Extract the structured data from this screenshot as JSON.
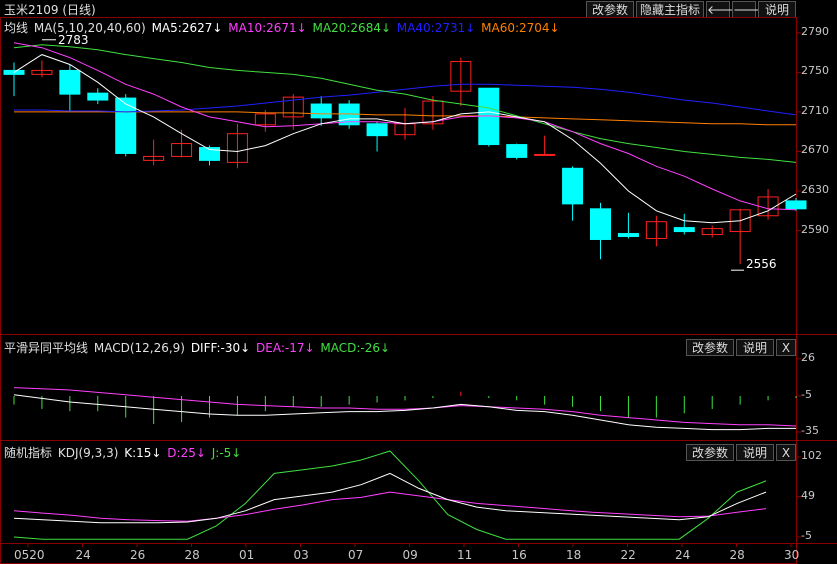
{
  "window": {
    "title": "玉米2109 (日线)"
  },
  "toolbar": {
    "params_label": "改参数",
    "hide_label": "隐藏主指标",
    "left_arrow": "🡐",
    "right_arrow": "🡒",
    "help_label": "说明",
    "close_label": "X"
  },
  "legends": {
    "ma": {
      "name": "均线",
      "params": "MA(5,10,20,40,60)",
      "items": [
        "MA5:2627↓",
        "MA10:2671↓",
        "MA20:2684↓",
        "MA40:2731↓",
        "MA60:2704↓"
      ],
      "colors": [
        "#ffffff",
        "#ff40ff",
        "#40e040",
        "#2020ff",
        "#ff8000"
      ]
    },
    "macd": {
      "name": "平滑异同平均线",
      "params": "MACD(12,26,9)",
      "items": [
        "DIFF:-30↓",
        "DEA:-17↓",
        "MACD:-26↓"
      ],
      "colors": [
        "#ffffff",
        "#ff40ff",
        "#40e040"
      ]
    },
    "kdj": {
      "name": "随机指标",
      "params": "KDJ(9,3,3)",
      "items": [
        "K:15↓",
        "D:25↓",
        "J:-5↓"
      ],
      "colors": [
        "#ffffff",
        "#ff40ff",
        "#40e040"
      ]
    }
  },
  "chart_data": {
    "type": "candlestick",
    "x_labels": [
      "0520",
      "24",
      "26",
      "28",
      "01",
      "03",
      "07",
      "09",
      "11",
      "16",
      "18",
      "22",
      "24",
      "28",
      "30"
    ],
    "main": {
      "yticks": [
        2790,
        2750,
        2710,
        2670,
        2630,
        2590
      ],
      "annotations": {
        "high": "2783",
        "low": "2556"
      },
      "candles": [
        {
          "o": 2752,
          "c": 2748,
          "h": 2760,
          "l": 2726
        },
        {
          "o": 2748,
          "c": 2752,
          "h": 2762,
          "l": 2745
        },
        {
          "o": 2752,
          "c": 2728,
          "h": 2758,
          "l": 2710
        },
        {
          "o": 2729,
          "c": 2722,
          "h": 2734,
          "l": 2718
        },
        {
          "o": 2724,
          "c": 2668,
          "h": 2728,
          "l": 2665
        },
        {
          "o": 2661,
          "c": 2665,
          "h": 2682,
          "l": 2656
        },
        {
          "o": 2665,
          "c": 2678,
          "h": 2692,
          "l": 2664
        },
        {
          "o": 2674,
          "c": 2661,
          "h": 2676,
          "l": 2656
        },
        {
          "o": 2659,
          "c": 2688,
          "h": 2698,
          "l": 2653
        },
        {
          "o": 2697,
          "c": 2708,
          "h": 2712,
          "l": 2690
        },
        {
          "o": 2705,
          "c": 2725,
          "h": 2728,
          "l": 2692
        },
        {
          "o": 2718,
          "c": 2704,
          "h": 2726,
          "l": 2696
        },
        {
          "o": 2718,
          "c": 2697,
          "h": 2722,
          "l": 2693
        },
        {
          "o": 2698,
          "c": 2686,
          "h": 2700,
          "l": 2670
        },
        {
          "o": 2687,
          "c": 2698,
          "h": 2714,
          "l": 2682
        },
        {
          "o": 2698,
          "c": 2721,
          "h": 2726,
          "l": 2692
        },
        {
          "o": 2731,
          "c": 2761,
          "h": 2765,
          "l": 2716
        },
        {
          "o": 2734,
          "c": 2677,
          "h": 2734,
          "l": 2675
        },
        {
          "o": 2677,
          "c": 2664,
          "h": 2678,
          "l": 2662
        },
        {
          "o": 2666,
          "c": 2667,
          "h": 2686,
          "l": 2666
        },
        {
          "o": 2653,
          "c": 2617,
          "h": 2655,
          "l": 2600
        },
        {
          "o": 2612,
          "c": 2581,
          "h": 2618,
          "l": 2561
        },
        {
          "o": 2587,
          "c": 2584,
          "h": 2608,
          "l": 2582
        },
        {
          "o": 2582,
          "c": 2599,
          "h": 2605,
          "l": 2574
        },
        {
          "o": 2593,
          "c": 2589,
          "h": 2607,
          "l": 2586
        },
        {
          "o": 2586,
          "c": 2592,
          "h": 2595,
          "l": 2583
        },
        {
          "o": 2589,
          "c": 2611,
          "h": 2612,
          "l": 2556
        },
        {
          "o": 2605,
          "c": 2624,
          "h": 2632,
          "l": 2601
        },
        {
          "o": 2620,
          "c": 2612,
          "h": 2623,
          "l": 2610
        }
      ],
      "ma5": [
        2750,
        2768,
        2758,
        2740,
        2718,
        2705,
        2688,
        2672,
        2670,
        2676,
        2688,
        2698,
        2703,
        2703,
        2698,
        2700,
        2708,
        2710,
        2705,
        2700,
        2682,
        2658,
        2630,
        2610,
        2600,
        2598,
        2600,
        2610,
        2627
      ],
      "ma10": [
        2780,
        2775,
        2765,
        2752,
        2738,
        2728,
        2715,
        2705,
        2700,
        2695,
        2696,
        2698,
        2700,
        2700,
        2698,
        2700,
        2705,
        2706,
        2704,
        2700,
        2690,
        2678,
        2668,
        2655,
        2645,
        2632,
        2620,
        2612,
        2611
      ],
      "ma20": [
        2775,
        2778,
        2776,
        2773,
        2768,
        2764,
        2760,
        2755,
        2752,
        2750,
        2748,
        2744,
        2738,
        2732,
        2728,
        2722,
        2718,
        2714,
        2706,
        2698,
        2690,
        2683,
        2678,
        2674,
        2670,
        2667,
        2664,
        2662,
        2659
      ],
      "ma40": [
        2712,
        2712,
        2711,
        2711,
        2710,
        2711,
        2712,
        2714,
        2716,
        2719,
        2722,
        2725,
        2727,
        2730,
        2733,
        2736,
        2738,
        2738,
        2737,
        2736,
        2735,
        2733,
        2730,
        2726,
        2722,
        2719,
        2715,
        2711,
        2707
      ],
      "ma60": [
        2710,
        2710,
        2710,
        2710,
        2710,
        2710,
        2710,
        2710,
        2710,
        2709,
        2709,
        2708,
        2708,
        2707,
        2707,
        2706,
        2706,
        2706,
        2705,
        2704,
        2703,
        2702,
        2701,
        2700,
        2699,
        2698,
        2698,
        2697,
        2697
      ]
    },
    "macd": {
      "yticks": [
        26,
        -5,
        -35
      ],
      "diff": [
        -4,
        -7,
        -10,
        -12,
        -14,
        -16,
        -18,
        -20,
        -21,
        -21,
        -20,
        -19,
        -18,
        -18,
        -17,
        -15,
        -12,
        -14,
        -17,
        -18,
        -21,
        -25,
        -29,
        -31,
        -32,
        -33,
        -33,
        -32,
        -32
      ],
      "dea": [
        2,
        1,
        0,
        -2,
        -4,
        -6,
        -8,
        -10,
        -12,
        -13,
        -14,
        -15,
        -15,
        -16,
        -16,
        -15,
        -13,
        -14,
        -15,
        -16,
        -18,
        -21,
        -23,
        -25,
        -27,
        -28,
        -29,
        -29,
        -30
      ],
      "bar": [
        -8,
        -12,
        -14,
        -14,
        -20,
        -26,
        -24,
        -20,
        -18,
        -14,
        -10,
        -10,
        -8,
        -6,
        -4,
        -2,
        4,
        -2,
        -4,
        -8,
        -10,
        -14,
        -20,
        -20,
        -16,
        -12,
        -8,
        -4,
        -2
      ]
    },
    "kdj": {
      "yticks": [
        102,
        49,
        -5
      ],
      "k": [
        20,
        18,
        16,
        14,
        14,
        14,
        15,
        20,
        30,
        45,
        50,
        55,
        65,
        80,
        60,
        45,
        35,
        30,
        28,
        26,
        24,
        22,
        20,
        18,
        22,
        40,
        55
      ],
      "d": [
        30,
        27,
        24,
        20,
        18,
        17,
        16,
        20,
        25,
        32,
        38,
        45,
        48,
        55,
        50,
        45,
        40,
        37,
        34,
        31,
        28,
        26,
        24,
        22,
        23,
        28,
        33
      ],
      "j": [
        -5,
        -10,
        -15,
        -20,
        -20,
        -15,
        -8,
        10,
        40,
        80,
        85,
        90,
        98,
        115,
        70,
        25,
        5,
        -10,
        -15,
        -15,
        -15,
        -12,
        -10,
        -8,
        20,
        55,
        70
      ]
    }
  }
}
